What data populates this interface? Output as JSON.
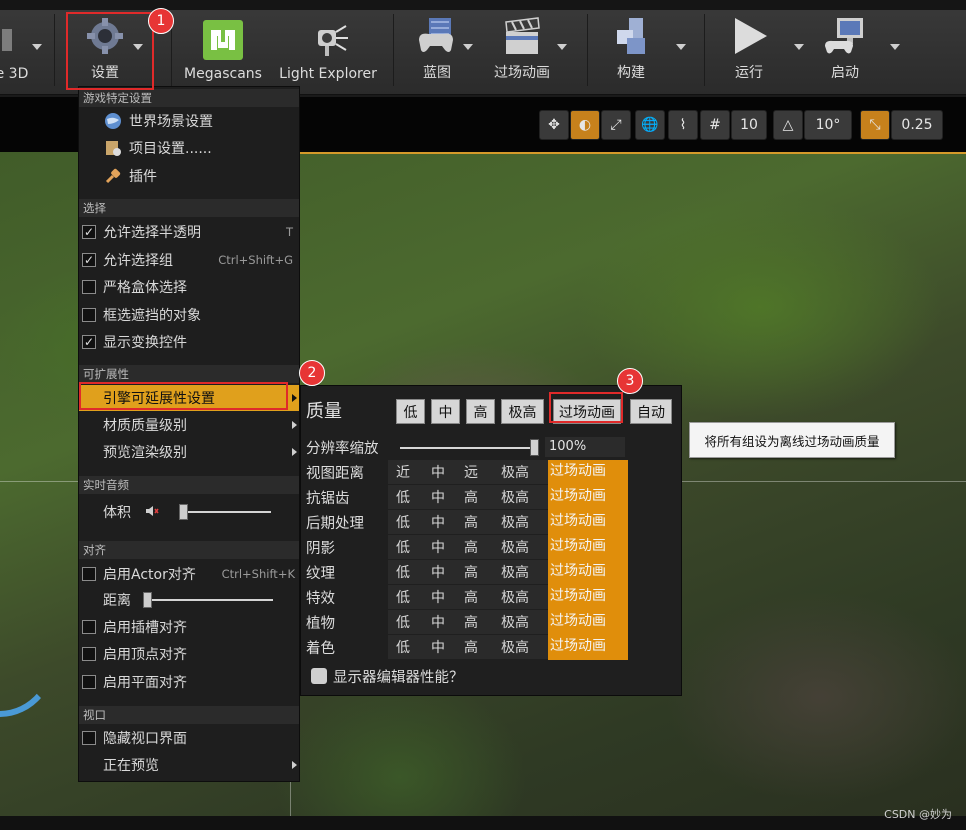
{
  "toolbar": {
    "items": [
      {
        "label": "e 3D",
        "icon": "modes-icon"
      },
      {
        "label": "设置",
        "icon": "gear-icon"
      },
      {
        "label": "Megascans",
        "icon": "megascans-logo-icon"
      },
      {
        "label": "Light Explorer",
        "icon": "spotlight-icon"
      },
      {
        "label": "蓝图",
        "icon": "blueprint-gamepad-icon"
      },
      {
        "label": "过场动画",
        "icon": "clapperboard-icon"
      },
      {
        "label": "构建",
        "icon": "cubes-icon"
      },
      {
        "label": "运行",
        "icon": "play-icon"
      },
      {
        "label": "启动",
        "icon": "launch-monitor-icon"
      }
    ]
  },
  "viewport_tools": {
    "grid_snap": "10",
    "rotate_snap": "10°",
    "scale_snap": "0.25"
  },
  "settings_menu": {
    "sections": {
      "game": "游戏特定设置",
      "selection": "选择",
      "scalability": "可扩展性",
      "audio": "实时音频",
      "snap": "对齐",
      "viewport": "视口"
    },
    "game_items": [
      {
        "label": "世界场景设置",
        "icon": "globe-icon"
      },
      {
        "label": "项目设置......",
        "icon": "project-settings-icon"
      },
      {
        "label": "插件",
        "icon": "plug-icon"
      }
    ],
    "selection_items": [
      {
        "label": "允许选择半透明",
        "checked": true,
        "shortcut": "T"
      },
      {
        "label": "允许选择组",
        "checked": true,
        "shortcut": "Ctrl+Shift+G"
      },
      {
        "label": "严格盒体选择",
        "checked": false,
        "shortcut": ""
      },
      {
        "label": "框选遮挡的对象",
        "checked": false,
        "shortcut": ""
      },
      {
        "label": "显示变换控件",
        "checked": true,
        "shortcut": ""
      }
    ],
    "scalability_items": [
      {
        "label": "引擎可延展性设置"
      },
      {
        "label": "材质质量级别"
      },
      {
        "label": "预览渲染级别"
      }
    ],
    "audio_volume_label": "体积",
    "audio_volume_level": 0.0,
    "snap_items": {
      "actor_snap": {
        "label": "启用Actor对齐",
        "checked": false,
        "shortcut": "Ctrl+Shift+K"
      },
      "distance_label": "距离",
      "distance_level": 0.0,
      "socket_snap": {
        "label": "启用插槽对齐",
        "checked": false
      },
      "vertex_snap": {
        "label": "启用顶点对齐",
        "checked": false
      },
      "plane_snap": {
        "label": "启用平面对齐",
        "checked": false
      }
    },
    "viewport_items": {
      "hide_ui": {
        "label": "隐藏视口界面",
        "checked": false
      },
      "previewing": {
        "label": "正在预览"
      }
    }
  },
  "scalability": {
    "title": "质量",
    "preset_buttons": [
      "低",
      "中",
      "高",
      "极高",
      "过场动画",
      "自动"
    ],
    "resolution_label": "分辨率缩放",
    "resolution_value": "100%",
    "resolution_level": 1.0,
    "rows": [
      {
        "name": "视图距离",
        "levels": [
          "近",
          "中",
          "远",
          "极高"
        ],
        "cinematic": "过场动画"
      },
      {
        "name": "抗锯齿",
        "levels": [
          "低",
          "中",
          "高",
          "极高"
        ],
        "cinematic": "过场动画"
      },
      {
        "name": "后期处理",
        "levels": [
          "低",
          "中",
          "高",
          "极高"
        ],
        "cinematic": "过场动画"
      },
      {
        "name": "阴影",
        "levels": [
          "低",
          "中",
          "高",
          "极高"
        ],
        "cinematic": "过场动画"
      },
      {
        "name": "纹理",
        "levels": [
          "低",
          "中",
          "高",
          "极高"
        ],
        "cinematic": "过场动画"
      },
      {
        "name": "特效",
        "levels": [
          "低",
          "中",
          "高",
          "极高"
        ],
        "cinematic": "过场动画"
      },
      {
        "name": "植物",
        "levels": [
          "低",
          "中",
          "高",
          "极高"
        ],
        "cinematic": "过场动画"
      },
      {
        "name": "着色",
        "levels": [
          "低",
          "中",
          "高",
          "极高"
        ],
        "cinematic": "过场动画"
      }
    ],
    "show_perf_label": "显示器编辑器性能？",
    "show_perf_checked": false
  },
  "tooltip": {
    "text": "将所有组设为离线过场动画质量"
  },
  "annotations": [
    "1",
    "2",
    "3"
  ],
  "watermark": "CSDN @妙为",
  "colors": {
    "accent": "#e08e0b",
    "highlight": "#e0a01c",
    "annotation": "#e02a2a"
  }
}
